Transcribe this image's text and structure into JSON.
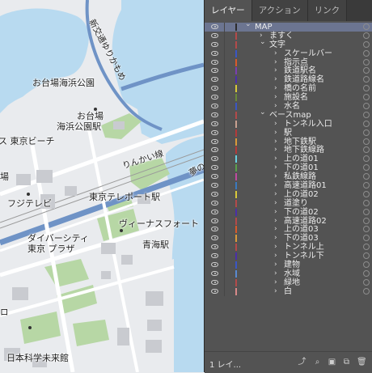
{
  "map": {
    "labels": {
      "odaiba_kaihin_park": "お台場海浜公園",
      "odaiba_kaihin_koen_station_1": "お台場",
      "odaiba_kaihin_koen_station_2": "海浜公園駅",
      "tokyo_beach": "ス 東京ビーチ",
      "ba_fragment": "場",
      "fuji_tv": "フジテレビ",
      "rinkai_line": "りんかい線",
      "tokyo_teleport": "東京テレポート駅",
      "yume_fragment": "夢の",
      "diver_city_1": "ダイバーシティ",
      "diver_city_2": "東京 プラザ",
      "venus_fort": "ヴィーナスフォート",
      "aomi_station": "青海駅",
      "miraikan": "日本科学未来館",
      "ro_fragment": "ロ",
      "yurikamome_vertical": "新交通ゆりかもめ"
    }
  },
  "panel": {
    "tabs": [
      "レイヤー",
      "アクション",
      "リンク"
    ],
    "layers": [
      {
        "name": "MAP",
        "level": 0,
        "expanded": true,
        "color": "#2c2c2c",
        "selected": true
      },
      {
        "name": "ますく",
        "level": 1,
        "expanded": false,
        "color": "#b34a4a"
      },
      {
        "name": "文字",
        "level": 1,
        "expanded": true,
        "color": "#b34a4a"
      },
      {
        "name": "スケールバー",
        "level": 2,
        "expanded": false,
        "color": "#3a56c5"
      },
      {
        "name": "指示点",
        "level": 2,
        "expanded": false,
        "color": "#d95a2a"
      },
      {
        "name": "鉄道駅名",
        "level": 2,
        "expanded": false,
        "color": "#7b3fb0"
      },
      {
        "name": "鉄道路線名",
        "level": 2,
        "expanded": false,
        "color": "#4b2fa8"
      },
      {
        "name": "橋の名前",
        "level": 2,
        "expanded": false,
        "color": "#d8c93a"
      },
      {
        "name": "施設名",
        "level": 2,
        "expanded": false,
        "color": "#6a8a3a"
      },
      {
        "name": "水名",
        "level": 2,
        "expanded": false,
        "color": "#3a56c5"
      },
      {
        "name": "ベースmap",
        "level": 1,
        "expanded": true,
        "color": "#b34a4a"
      },
      {
        "name": "トンネル入口",
        "level": 2,
        "expanded": false,
        "color": "#c8a090"
      },
      {
        "name": "駅",
        "level": 2,
        "expanded": false,
        "color": "#b33a3a"
      },
      {
        "name": "地下鉄駅",
        "level": 2,
        "expanded": false,
        "color": "#d99a3a"
      },
      {
        "name": "地下鉄線路",
        "level": 2,
        "expanded": false,
        "color": "#b33a3a"
      },
      {
        "name": "上の道01",
        "level": 2,
        "expanded": false,
        "color": "#6ad0e0"
      },
      {
        "name": "下の道01",
        "level": 2,
        "expanded": false,
        "color": "#5aa04a"
      },
      {
        "name": "私鉄線路",
        "level": 2,
        "expanded": false,
        "color": "#c04aa0"
      },
      {
        "name": "高速道路01",
        "level": 2,
        "expanded": false,
        "color": "#3a7ac0"
      },
      {
        "name": "上の道02",
        "level": 2,
        "expanded": false,
        "color": "#d8c93a"
      },
      {
        "name": "道塗り",
        "level": 2,
        "expanded": false,
        "color": "#b34a4a"
      },
      {
        "name": "下の道02",
        "level": 2,
        "expanded": false,
        "color": "#4b2fa8"
      },
      {
        "name": "高速道路02",
        "level": 2,
        "expanded": false,
        "color": "#b34a4a"
      },
      {
        "name": "上の道03",
        "level": 2,
        "expanded": false,
        "color": "#d95a2a"
      },
      {
        "name": "下の道03",
        "level": 2,
        "expanded": false,
        "color": "#d99a3a"
      },
      {
        "name": "トンネル上",
        "level": 2,
        "expanded": false,
        "color": "#b34a4a"
      },
      {
        "name": "トンネル下",
        "level": 2,
        "expanded": false,
        "color": "#4b2fa8"
      },
      {
        "name": "建物",
        "level": 2,
        "expanded": false,
        "color": "#3a56c5"
      },
      {
        "name": "水域",
        "level": 2,
        "expanded": false,
        "color": "#5a8ad0"
      },
      {
        "name": "緑地",
        "level": 2,
        "expanded": false,
        "color": "#b34a4a"
      },
      {
        "name": "白",
        "level": 2,
        "expanded": false,
        "color": "#d88a8a"
      }
    ],
    "footer_count": "1 レイ..."
  }
}
